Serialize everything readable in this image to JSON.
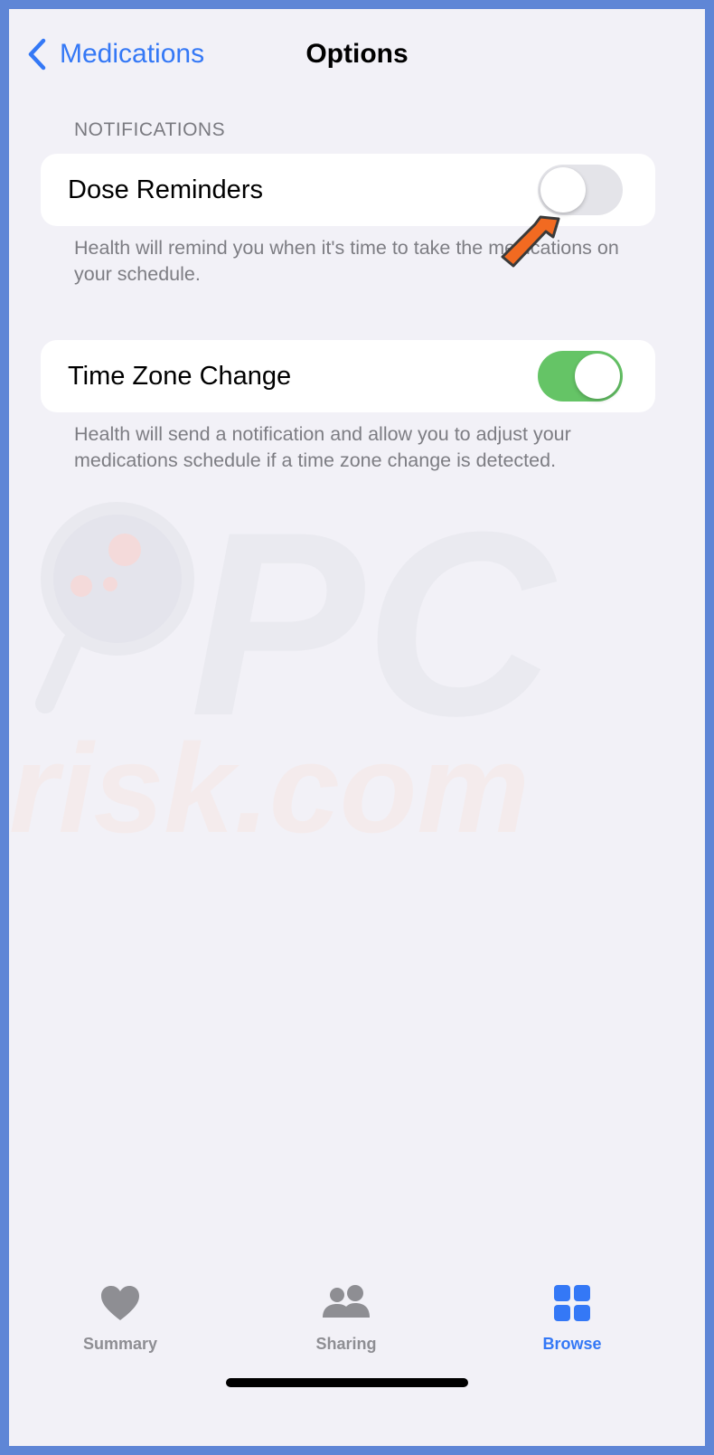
{
  "nav": {
    "back_label": "Medications",
    "title": "Options"
  },
  "notifications": {
    "header": "NOTIFICATIONS",
    "dose_reminders": {
      "label": "Dose Reminders",
      "enabled": false,
      "footer": "Health will remind you when it's time to take the medications on your schedule."
    },
    "time_zone_change": {
      "label": "Time Zone Change",
      "enabled": true,
      "footer": "Health will send a notification and allow you to adjust your medications schedule if a time zone change is detected."
    }
  },
  "watermark": {
    "line1": "PC",
    "line2": "risk.com"
  },
  "tabbar": {
    "tabs": [
      {
        "label": "Summary",
        "icon": "heart-icon",
        "active": false
      },
      {
        "label": "Sharing",
        "icon": "people-icon",
        "active": false
      },
      {
        "label": "Browse",
        "icon": "grid-icon",
        "active": true
      }
    ]
  },
  "colors": {
    "accent": "#3478f6",
    "toggle_on": "#65c466",
    "toggle_off": "#e4e4e9",
    "arrow": "#f26a21",
    "background": "#f2f1f7"
  }
}
